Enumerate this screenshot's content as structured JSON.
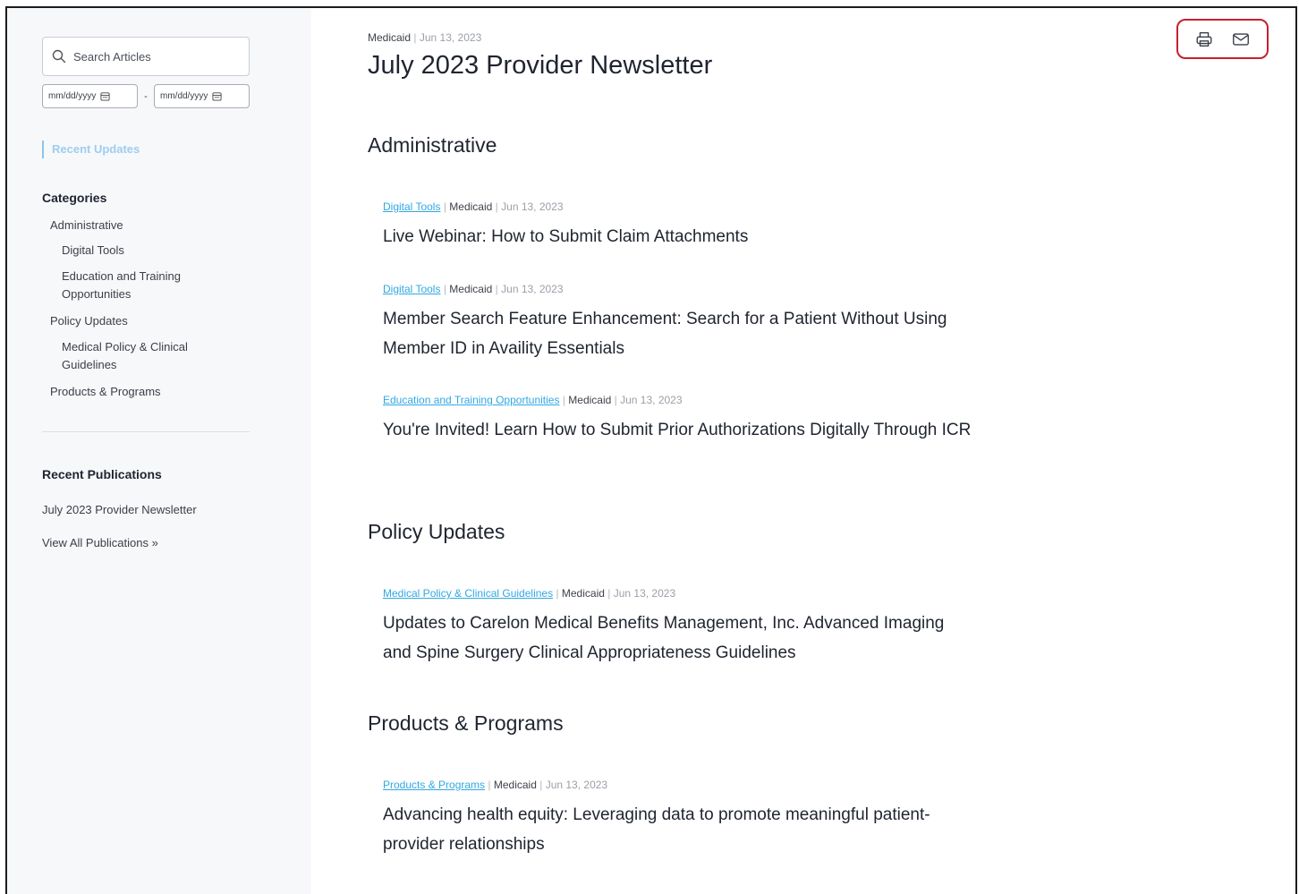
{
  "sidebar": {
    "search_placeholder": "Search Articles",
    "date_from_placeholder": "mm/dd/yyyy",
    "date_separator": "-",
    "date_to_placeholder": "mm/dd/yyyy",
    "recent_updates": "Recent Updates",
    "categories_heading": "Categories",
    "categories": [
      {
        "label": "Administrative"
      },
      {
        "label": "Digital Tools"
      },
      {
        "label": "Education and Training Opportunities"
      },
      {
        "label": "Policy Updates"
      },
      {
        "label": "Medical Policy & Clinical Guidelines"
      },
      {
        "label": "Products & Programs"
      }
    ],
    "recent_publications_heading": "Recent Publications",
    "publication_link": "July 2023 Provider Newsletter",
    "view_all": "View All Publications »"
  },
  "page": {
    "program": "Medicaid",
    "separator": "|",
    "date": "Jun 13, 2023",
    "title": "July 2023 Provider Newsletter"
  },
  "actions": {
    "print_icon": "printer-icon",
    "email_icon": "mail-icon",
    "accent_color": "#c6202f"
  },
  "sections": [
    {
      "title": "Administrative",
      "articles": [
        {
          "category": "Digital Tools",
          "program": "Medicaid",
          "date": "Jun 13, 2023",
          "title": "Live Webinar: How to Submit Claim Attachments"
        },
        {
          "category": "Digital Tools",
          "program": "Medicaid",
          "date": "Jun 13, 2023",
          "title": "Member Search Feature Enhancement: Search for a Patient Without Using Member ID in Availity Essentials"
        },
        {
          "category": "Education and Training Opportunities",
          "program": "Medicaid",
          "date": "Jun 13, 2023",
          "title": "You're Invited! Learn How to Submit Prior Authorizations Digitally Through ICR"
        }
      ]
    },
    {
      "title": "Policy Updates",
      "articles": [
        {
          "category": "Medical Policy & Clinical Guidelines",
          "program": "Medicaid",
          "date": "Jun 13, 2023",
          "title": "Updates to Carelon Medical Benefits Management, Inc. Advanced Imaging and Spine Surgery Clinical Appropriateness Guidelines"
        }
      ]
    },
    {
      "title": "Products & Programs",
      "articles": [
        {
          "category": "Products & Programs",
          "program": "Medicaid",
          "date": "Jun 13, 2023",
          "title": "Advancing health equity: Leveraging data to promote meaningful patient-provider relationships"
        }
      ]
    }
  ],
  "colors": {
    "category_link": "#30a8e3",
    "recent_updates": "#9ecdf0",
    "sidebar_bg": "#f7f8fa"
  }
}
